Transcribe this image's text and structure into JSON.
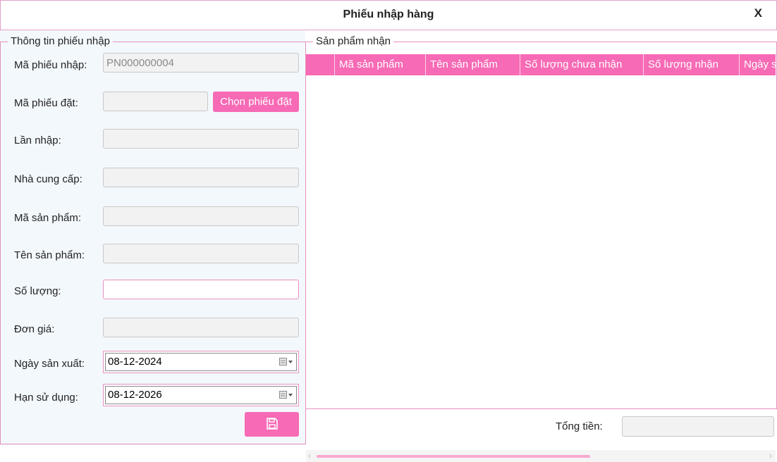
{
  "window": {
    "title": "Phiếu nhập hàng",
    "close_label": "X"
  },
  "left": {
    "legend": "Thông tin phiếu nhập",
    "fields": {
      "ma_phieu_nhap": {
        "label": "Mã phiếu nhập:",
        "value": "PN000000004"
      },
      "ma_phieu_dat": {
        "label": "Mã phiếu đặt:",
        "value": ""
      },
      "lan_nhap": {
        "label": "Lần nhập:",
        "value": ""
      },
      "nha_cung_cap": {
        "label": "Nhà cung cấp:",
        "value": ""
      },
      "ma_san_pham": {
        "label": "Mã sản phẩm:",
        "value": ""
      },
      "ten_san_pham": {
        "label": "Tên sản phẩm:",
        "value": ""
      },
      "so_luong": {
        "label": "Số lượng:",
        "value": ""
      },
      "don_gia": {
        "label": "Đơn giá:",
        "value": ""
      },
      "ngay_san_xuat": {
        "label": "Ngày sản xuất:",
        "value": "08-12-2024"
      },
      "han_su_dung": {
        "label": "Hạn sử dụng:",
        "value": "08-12-2026"
      }
    },
    "choose_order_button": "Chọn phiếu đặt",
    "save_icon": "floppy-disk-icon"
  },
  "right": {
    "legend": "Sản phẩm nhận",
    "columns": [
      "Mã sản phẩm",
      "Tên sản phẩm",
      "Số lượng chưa nhận",
      "Số lượng nhận",
      "Ngày sả"
    ],
    "rows": [],
    "total_label": "Tổng tiền:",
    "total_value": ""
  },
  "colors": {
    "accent": "#f76ab5",
    "border": "#e590bd",
    "panel_bg": "#f3f8fd"
  }
}
